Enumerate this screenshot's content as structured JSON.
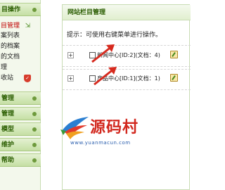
{
  "sidebar": {
    "groups": [
      {
        "title": "栏目操作",
        "link_items": [
          "网站栏目管理",
          "绑定案列表",
          "更新的栏目档案",
          "我发布的文档",
          "稿件管理",
          "内容回收站"
        ]
      },
      {
        "title": "档案管理"
      },
      {
        "title": "文档管理"
      },
      {
        "title": "批量维护模型"
      },
      {
        "title": "系统维护"
      },
      {
        "title": "模板帮助"
      }
    ],
    "visible": {
      "g0_head": "目操作",
      "l0": "目管理",
      "l1": "案列表",
      "l2": "的档案",
      "l3": "的文档",
      "l4": "理",
      "l5": "收站",
      "g1_head": "管理",
      "g2_head": "管理",
      "g3_head": "模型",
      "g4_head": "维护",
      "g5_head": "帮助"
    }
  },
  "panel": {
    "title": "网站栏目管理",
    "hint": "提示：可使用右键菜单进行操作。",
    "rows": [
      {
        "label": "新闻中心[ID:2](文档：4)"
      },
      {
        "label": "产品中心[ID:1](文档：1)"
      }
    ]
  },
  "watermark": {
    "text": "源码村",
    "url": "www.yuanmacun.com"
  },
  "colors": {
    "sidebar_bg": "#f3f8ec",
    "header_green": "#2a5d00",
    "active_link": "#c00000",
    "watermark_red": "#d2281e",
    "watermark_blue": "#2b5fae"
  }
}
